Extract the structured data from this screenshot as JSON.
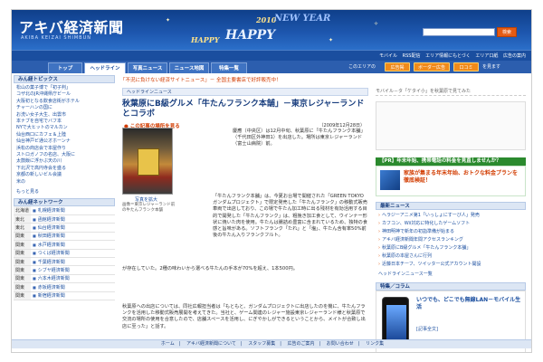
{
  "header": {
    "logo": "アキバ経済新聞",
    "logo_sub": "AKIBA KEIZAI SHIMBUN",
    "banner_happy1": "HAPPY",
    "banner_year": "2010",
    "banner_newyear": "NEW YEAR",
    "banner_happy2": "HAPPY",
    "search_button": "検索"
  },
  "utilbar": {
    "links": [
      "モバイル",
      "RSS配信",
      "エリア情報にもとづく",
      "エリア口紙",
      "広告の案内"
    ]
  },
  "tabs": [
    "トップ",
    "ヘッドライン",
    "写真ニュース",
    "ニュース地図",
    "特集一覧"
  ],
  "tabbar_right": {
    "label": "このエリアの",
    "pills": [
      "広告掲",
      "ボーダー広告",
      "口コミ"
    ],
    "suffix": "を見ます"
  },
  "ticker": "「不況に負けない経済サイトニュース」－ 全国主要書店で好評販売中！",
  "left": {
    "topics_header": "みん経トピックス",
    "topics": [
      "松山の菓子博で「初子判」",
      "コザ北のJR沖縄県庁ビール",
      "大阪初となる飲食店街がホテル",
      "チャーハンの国に",
      "お洗い女子大生、出雲市",
      "本ナブを自宅でバフ本",
      "NYで大ヒットのマルカン",
      "仙台西口にカフェ＆上陸",
      "仙台神戸ビ通公オホーンナ",
      "浜松の商店会で本屋作り",
      "ストロガノフの名店、大阪に",
      "太鼓飯に浮かぶ天の川",
      "下北沢で高円寺会を盛る",
      "京都の新しいビル会議",
      "米の"
    ],
    "more": "もっと見る",
    "network_header": "みん経ネットワーク",
    "network": [
      {
        "region": "北海道",
        "name": "札幌経済新聞"
      },
      {
        "region": "東北",
        "name": "函館経済新聞"
      },
      {
        "region": "東北",
        "name": "仙台経済新聞"
      },
      {
        "region": "関東",
        "name": "秋田経済新聞"
      },
      {
        "region": "関東",
        "name": "水戸経済新聞"
      },
      {
        "region": "関東",
        "name": "つくば経済新聞"
      },
      {
        "region": "関東",
        "name": "千葉経済新聞"
      },
      {
        "region": "関東",
        "name": "シブヤ経済新聞"
      },
      {
        "region": "関東",
        "name": "六本木経済新聞"
      },
      {
        "region": "関東",
        "name": "赤坂経済新聞"
      },
      {
        "region": "関東",
        "name": "新宿経済新聞"
      }
    ]
  },
  "main": {
    "crumb": "ヘッドラインニュース",
    "title": "秋葉原にB級グルメ「牛たんフランク本舗」－東京レジャーランドとコラボ",
    "place_link": "この記事の場所を見る",
    "date": "（2009年12月28日）",
    "body1": "慶應（中央区）は12月中旬、秋葉原に「牛たんフランク本舗」（千代田区外神田1）を出店した。場所は東京レジャーランド（富士山病院）前。",
    "photo_link": "写真を拡大",
    "caption": "画像＝東京レジャーランド前の牛たんフランク本舗",
    "quote": "「牛たんフランク本舗」は、今夏お台場で開催された「GREEN TOKYO ガンダムプロジェクト」で限定発売した「牛たんフランク」の移動式販売車両で出店しており、この場で牛たん加工時に出る残材を有効活用する目的で開発した「牛たんフランク」は、粗挽き加工食として、ウインナー形状に焼いた肉を使用。牛たんは腸詰め豊富に含まれているため、独特の食感と旨味がある。ソフトフランク「たれ」と「塩」、牛たん含有率50%前後の牛たん入りフランクフルト。",
    "body2": "が存在していた。2種の味わいから選べる牛たんの手本が70%を超え、1本500円。",
    "body3": "秋葉原への出店については、同社広報担当者は「もともと、ガンダムプロジェクトに出店したのを機に、牛たんフランクを活用した移動式販売展開を考えてきた。当社と、ゲーム関連のレジャー施設東京レジャーランド様と秋葉原で交流の場所の使用を合意したので、店舗スペースを活用し、にぎやかしができるということから、メイトが合致し出店に至った」と話す。"
  },
  "right": {
    "mobile": "モバイル－タ「ケタイ小」を秋葉原で見てみた",
    "pr_header": "【PR】年末年始、携帯電話の料金を見直しませんか？",
    "pr_text": "家族が集まる年末年始、おトクな料金プランを徹底検証！",
    "latest_header": "最新ニュース",
    "latest": [
      "ヘラジーアニメ第1「いっしょにすーび人」発売",
      "カフコン、Wii対応に特化したゲームソフト",
      "神田明神で新年の初詣準備が始まる",
      "アキバ経済新聞年間アクセスランキング",
      "秋葉原にB級グルメ「牛たんフランク本舗」",
      "秋葉原の本屋さんに行列",
      "近藤日本チーフ、ツイッター公式アカウント開設"
    ],
    "latest_more": "ヘッドラインニュース一覧",
    "special_header": "特集／コラム",
    "special_text": "いつでも、どこでも無線LAN－モバイル生活",
    "special_link": "[記事全文]"
  },
  "footer": [
    "ホーム",
    "アキバ経済新聞について",
    "スタッフ募集",
    "広告のご案内",
    "お問い合わせ",
    "リンク集"
  ]
}
